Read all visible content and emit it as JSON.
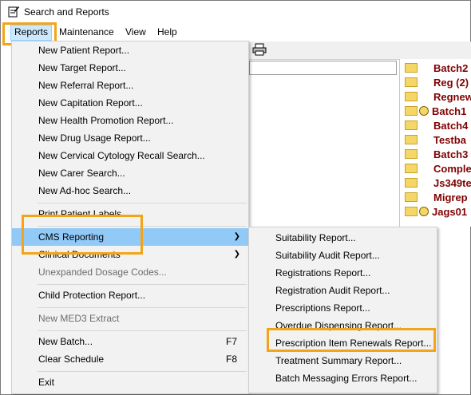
{
  "window": {
    "title": "Search and Reports"
  },
  "menubar": {
    "items": [
      "Reports",
      "Maintenance",
      "View",
      "Help"
    ]
  },
  "reports_menu": {
    "items": [
      {
        "label": "New Patient Report...",
        "shortcut": "",
        "disabled": false,
        "submenu": false
      },
      {
        "label": "New Target Report...",
        "shortcut": "",
        "disabled": false,
        "submenu": false
      },
      {
        "label": "New Referral Report...",
        "shortcut": "",
        "disabled": false,
        "submenu": false
      },
      {
        "label": "New Capitation Report...",
        "shortcut": "",
        "disabled": false,
        "submenu": false
      },
      {
        "label": "New Health Promotion Report...",
        "shortcut": "",
        "disabled": false,
        "submenu": false
      },
      {
        "label": "New Drug Usage Report...",
        "shortcut": "",
        "disabled": false,
        "submenu": false
      },
      {
        "label": "New Cervical Cytology Recall Search...",
        "shortcut": "",
        "disabled": false,
        "submenu": false
      },
      {
        "label": "New Carer Search...",
        "shortcut": "",
        "disabled": false,
        "submenu": false
      },
      {
        "label": "New Ad-hoc Search...",
        "shortcut": "",
        "disabled": false,
        "submenu": false
      },
      {
        "label": "Print Patient Labels...",
        "shortcut": "",
        "disabled": false,
        "submenu": false
      },
      {
        "label": "CMS Reporting",
        "shortcut": "",
        "disabled": false,
        "submenu": true,
        "selected": true
      },
      {
        "label": "Clinical Documents",
        "shortcut": "",
        "disabled": false,
        "submenu": true
      },
      {
        "label": "Unexpanded Dosage Codes...",
        "shortcut": "",
        "disabled": true,
        "submenu": false
      },
      {
        "label": "Child Protection Report...",
        "shortcut": "",
        "disabled": false,
        "submenu": false
      },
      {
        "label": "New MED3 Extract",
        "shortcut": "",
        "disabled": true,
        "submenu": false
      },
      {
        "label": "New Batch...",
        "shortcut": "F7",
        "disabled": false,
        "submenu": false
      },
      {
        "label": "Clear Schedule",
        "shortcut": "F8",
        "disabled": false,
        "submenu": false
      },
      {
        "label": "Exit",
        "shortcut": "",
        "disabled": false,
        "submenu": false
      }
    ]
  },
  "cms_submenu": {
    "items": [
      "Suitability Report...",
      "Suitability Audit Report...",
      "Registrations Report...",
      "Registration Audit Report...",
      "Prescriptions Report...",
      "Overdue Dispensing Report...",
      "Prescription Item Renewals Report...",
      "Treatment Summary Report...",
      "Batch Messaging Errors Report..."
    ]
  },
  "batch_list": {
    "items": [
      {
        "label": "Batch2",
        "clock": false
      },
      {
        "label": "Reg (2)",
        "clock": false
      },
      {
        "label": "Regnew",
        "clock": false
      },
      {
        "label": "Batch1",
        "clock": true
      },
      {
        "label": "Batch4",
        "clock": false
      },
      {
        "label": "Testba",
        "clock": false
      },
      {
        "label": "Batch3",
        "clock": false
      },
      {
        "label": "Comple",
        "clock": false
      },
      {
        "label": "Js349te",
        "clock": false
      },
      {
        "label": "Migrep",
        "clock": false
      },
      {
        "label": "Jags01",
        "clock": true
      }
    ]
  },
  "colors": {
    "highlight": "#f2a51a",
    "selected": "#91c9f7",
    "batch_text": "#800000"
  },
  "icons": {
    "title": "document-edit-icon",
    "printer": "printer-icon",
    "folder": "folder-icon",
    "clock": "clock-icon",
    "submenu_arrow": "chevron-right-icon"
  }
}
